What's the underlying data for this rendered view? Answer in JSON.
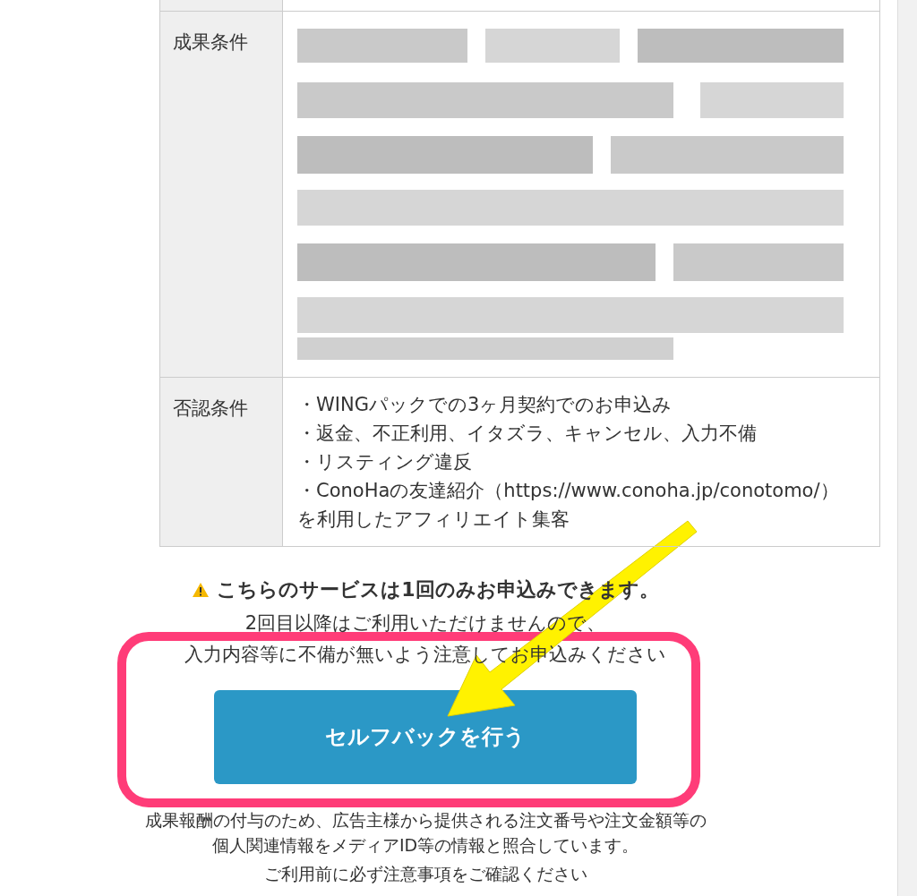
{
  "table": {
    "rows": [
      {
        "label": "成果条件"
      },
      {
        "label": "否認条件",
        "items": [
          "・WINGパックでの3ヶ月契約でのお申込み",
          "・返金、不正利用、イタズラ、キャンセル、入力不備",
          "・リスティング違反",
          "・ConoHaの友達紹介（https://www.conoha.jp/conotomo/）を利用したアフィリエイト集客"
        ]
      }
    ]
  },
  "notice": {
    "heading": "こちらのサービスは1回のみお申込みできます。",
    "lines": [
      "2回目以降はご利用いただけませんので、",
      "入力内容等に不備が無いよう注意してお申込みください"
    ]
  },
  "button": {
    "label": "セルフバックを行う"
  },
  "footer": {
    "lines": [
      "成果報酬の付与のため、広告主様から提供される注文番号や注文金額等の",
      "個人関連情報をメディアID等の情報と照合しています。",
      "ご利用前に必ず注意事項をご確認ください"
    ]
  }
}
